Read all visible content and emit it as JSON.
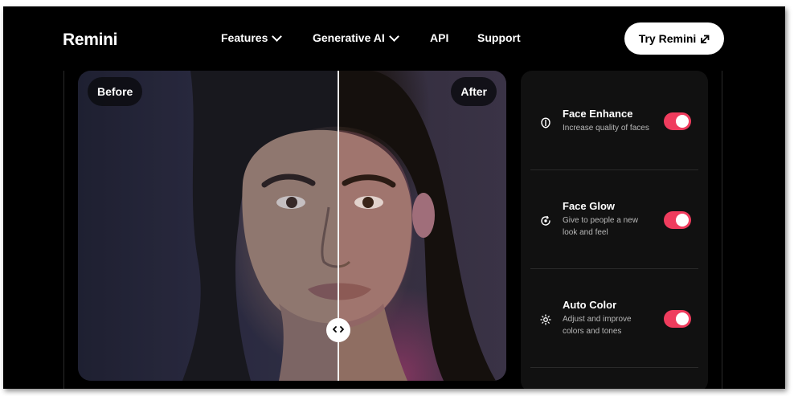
{
  "brand": {
    "name": "Remini"
  },
  "nav": {
    "items": [
      {
        "label": "Features",
        "has_dropdown": true
      },
      {
        "label": "Generative AI",
        "has_dropdown": true
      },
      {
        "label": "API",
        "has_dropdown": false
      },
      {
        "label": "Support",
        "has_dropdown": false
      }
    ],
    "cta_label": "Try Remini",
    "cta_icon": "external-link-icon"
  },
  "compare": {
    "before_label": "Before",
    "after_label": "After",
    "handle_icon": "left-right-arrows-icon",
    "divider_position": 0.606
  },
  "features": [
    {
      "title": "Face Enhance",
      "description": "Increase quality of faces",
      "icon": "face-shield-icon",
      "enabled": true
    },
    {
      "title": "Face Glow",
      "description": "Give to people a new look and feel",
      "icon": "glow-refresh-icon",
      "enabled": true
    },
    {
      "title": "Auto Color",
      "description": "Adjust and improve colors and tones",
      "icon": "sun-icon",
      "enabled": true
    }
  ],
  "colors": {
    "background": "#000000",
    "toggle_on": "#ef3c5d",
    "cta_bg": "#ffffff",
    "panel_bg": "#111111"
  }
}
